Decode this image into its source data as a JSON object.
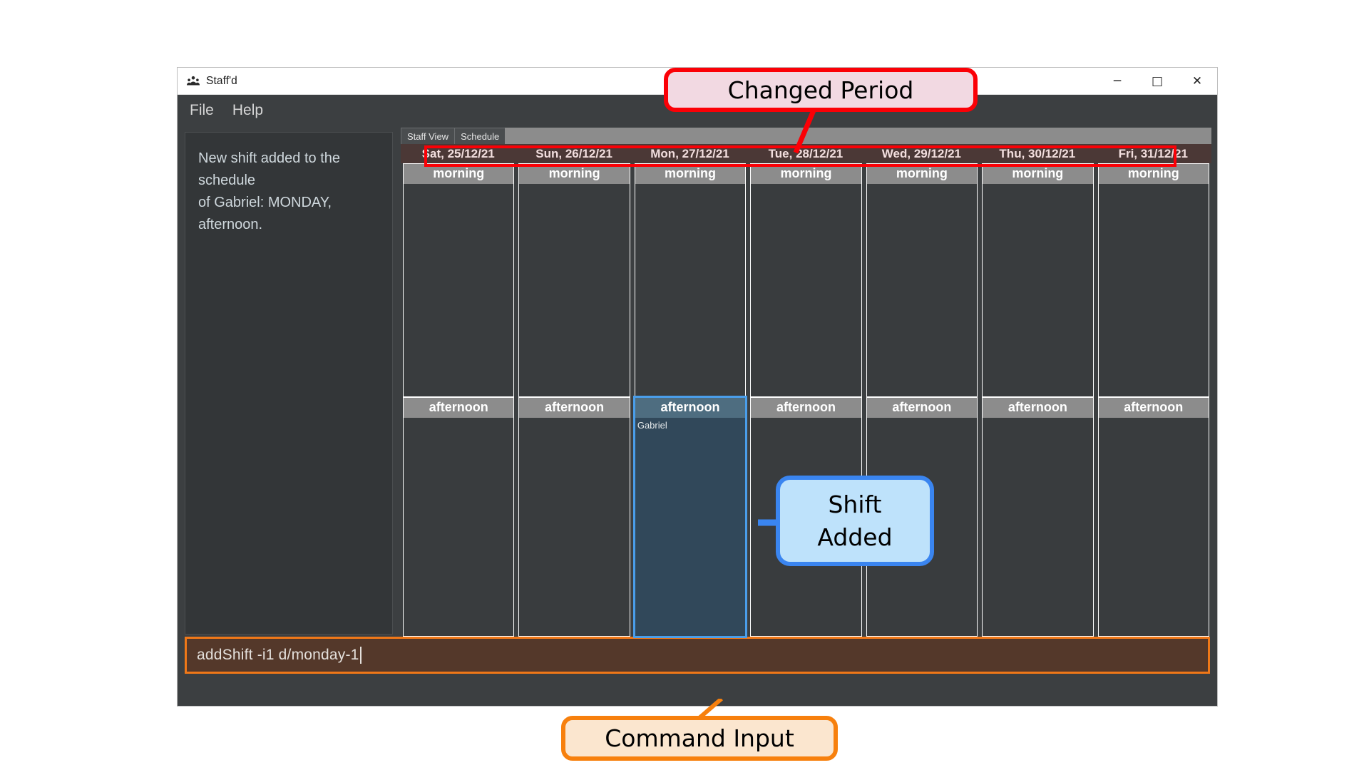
{
  "window": {
    "title": "Staff'd",
    "icon": "people-group-icon",
    "controls": {
      "minimize": "─",
      "maximize": "□",
      "close": "✕"
    }
  },
  "menu": {
    "items": [
      {
        "label": "File",
        "name": "menu-file"
      },
      {
        "label": "Help",
        "name": "menu-help"
      }
    ]
  },
  "result_panel": {
    "message": "New shift added to the schedule\nof Gabriel: MONDAY, afternoon."
  },
  "tabs": [
    {
      "label": "Staff View",
      "name": "tab-staff-view",
      "active": false
    },
    {
      "label": "Schedule",
      "name": "tab-schedule",
      "active": true
    }
  ],
  "schedule": {
    "days": [
      {
        "date": "Sat, 25/12/21",
        "selected": false,
        "slots": [
          {
            "label": "morning",
            "staff": []
          },
          {
            "label": "afternoon",
            "staff": []
          }
        ]
      },
      {
        "date": "Sun, 26/12/21",
        "selected": false,
        "slots": [
          {
            "label": "morning",
            "staff": []
          },
          {
            "label": "afternoon",
            "staff": []
          }
        ]
      },
      {
        "date": "Mon, 27/12/21",
        "selected": true,
        "slots": [
          {
            "label": "morning",
            "staff": []
          },
          {
            "label": "afternoon",
            "staff": [
              "Gabriel"
            ]
          }
        ]
      },
      {
        "date": "Tue, 28/12/21",
        "selected": false,
        "slots": [
          {
            "label": "morning",
            "staff": []
          },
          {
            "label": "afternoon",
            "staff": []
          }
        ]
      },
      {
        "date": "Wed, 29/12/21",
        "selected": false,
        "slots": [
          {
            "label": "morning",
            "staff": []
          },
          {
            "label": "afternoon",
            "staff": []
          }
        ]
      },
      {
        "date": "Thu, 30/12/21",
        "selected": false,
        "slots": [
          {
            "label": "morning",
            "staff": []
          },
          {
            "label": "afternoon",
            "staff": []
          }
        ]
      },
      {
        "date": "Fri, 31/12/21",
        "selected": false,
        "slots": [
          {
            "label": "morning",
            "staff": []
          },
          {
            "label": "afternoon",
            "staff": []
          }
        ]
      }
    ]
  },
  "command_input": {
    "value": "addShift -i1 d/monday-1",
    "placeholder": "Enter command here..."
  },
  "annotations": [
    {
      "name": "changed-period",
      "text": "Changed Period",
      "fill": "#f2d9e2",
      "stroke": "#fb0006"
    },
    {
      "name": "shift-added",
      "text": "Shift\nAdded",
      "fill": "#bee2fb",
      "stroke": "#3a85f0"
    },
    {
      "name": "command-input",
      "text": "Command Input",
      "fill": "#fbe6cf",
      "stroke": "#f7800d"
    }
  ],
  "colors": {
    "window_bg": "#3c3f41",
    "panel_bg": "#333638",
    "date_header": "#4b3836",
    "slot_header": "#8c8c8c",
    "cell_bg": "#393c3e",
    "selected_border": "#4a9eea",
    "selected_cell": "#31485a",
    "command_bg": "#54382a",
    "command_border": "#f07818"
  }
}
